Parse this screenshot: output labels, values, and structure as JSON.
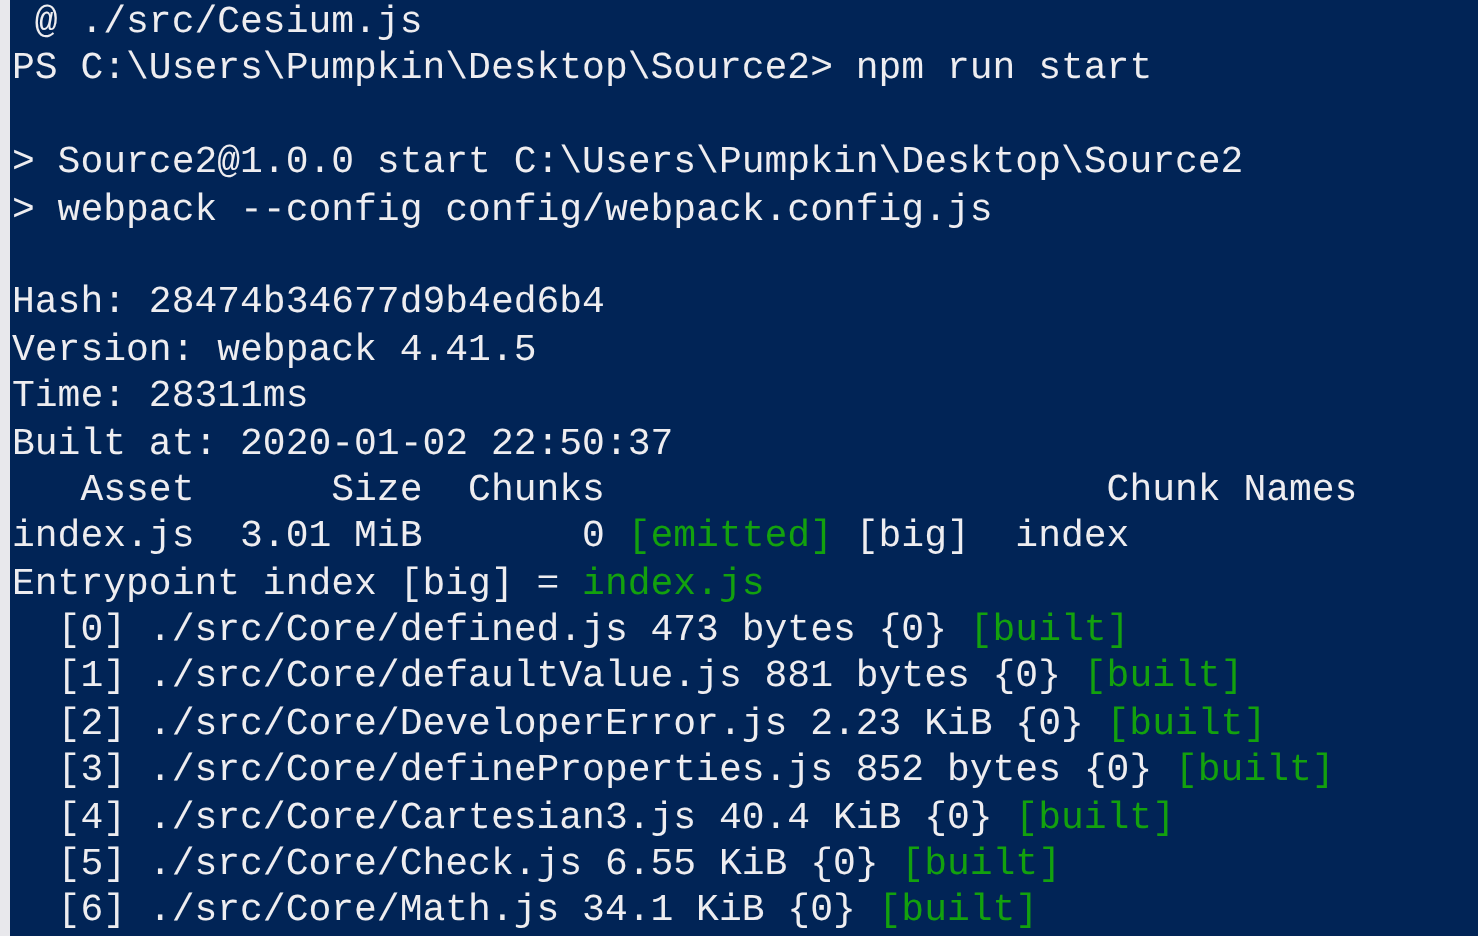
{
  "terminal": {
    "lines": [
      {
        "kind": "text",
        "segments": [
          {
            "text": " @ ./src/Cesium.js",
            "kind": "normal"
          }
        ]
      },
      {
        "kind": "text",
        "segments": [
          {
            "text": "PS C:\\Users\\Pumpkin\\Desktop\\Source2> npm run start",
            "kind": "normal"
          }
        ]
      },
      {
        "kind": "blank"
      },
      {
        "kind": "text",
        "segments": [
          {
            "text": "> Source2@1.0.0 start C:\\Users\\Pumpkin\\Desktop\\Source2",
            "kind": "normal"
          }
        ]
      },
      {
        "kind": "text",
        "segments": [
          {
            "text": "> webpack --config config/webpack.config.js",
            "kind": "normal"
          }
        ]
      },
      {
        "kind": "blank"
      },
      {
        "kind": "text",
        "segments": [
          {
            "text": "Hash: 28474b34677d9b4ed6b4",
            "kind": "normal"
          }
        ]
      },
      {
        "kind": "text",
        "segments": [
          {
            "text": "Version: webpack 4.41.5",
            "kind": "normal"
          }
        ]
      },
      {
        "kind": "text",
        "segments": [
          {
            "text": "Time: 28311ms",
            "kind": "normal"
          }
        ]
      },
      {
        "kind": "text",
        "segments": [
          {
            "text": "Built at: 2020-01-02 22:50:37",
            "kind": "normal"
          }
        ]
      },
      {
        "kind": "text",
        "segments": [
          {
            "text": "   Asset      Size  Chunks                      Chunk Names",
            "kind": "normal"
          }
        ]
      },
      {
        "kind": "text",
        "segments": [
          {
            "text": "index.js  3.01 MiB       0",
            "kind": "normal"
          },
          {
            "text": "[emitted]",
            "kind": "success"
          },
          {
            "text": "[big]  index",
            "kind": "normal"
          }
        ]
      },
      {
        "kind": "text",
        "segments": [
          {
            "text": "Entrypoint index [big] =",
            "kind": "normal"
          },
          {
            "text": "index.js",
            "kind": "success"
          }
        ]
      },
      {
        "kind": "text",
        "segments": [
          {
            "text": "  [0] ./src/Core/defined.js 473 bytes {0}",
            "kind": "normal"
          },
          {
            "text": "[built]",
            "kind": "success"
          }
        ]
      },
      {
        "kind": "text",
        "segments": [
          {
            "text": "  [1] ./src/Core/defaultValue.js 881 bytes {0}",
            "kind": "normal"
          },
          {
            "text": "[built]",
            "kind": "success"
          }
        ]
      },
      {
        "kind": "text",
        "segments": [
          {
            "text": "  [2] ./src/Core/DeveloperError.js 2.23 KiB {0}",
            "kind": "normal"
          },
          {
            "text": "[built]",
            "kind": "success"
          }
        ]
      },
      {
        "kind": "text",
        "segments": [
          {
            "text": "  [3] ./src/Core/defineProperties.js 852 bytes {0}",
            "kind": "normal"
          },
          {
            "text": "[built]",
            "kind": "success"
          }
        ]
      },
      {
        "kind": "text",
        "segments": [
          {
            "text": "  [4] ./src/Core/Cartesian3.js 40.4 KiB {0}",
            "kind": "normal"
          },
          {
            "text": "[built]",
            "kind": "success"
          }
        ]
      },
      {
        "kind": "text",
        "segments": [
          {
            "text": "  [5] ./src/Core/Check.js 6.55 KiB {0}",
            "kind": "normal"
          },
          {
            "text": "[built]",
            "kind": "success"
          }
        ]
      },
      {
        "kind": "text",
        "segments": [
          {
            "text": "  [6] ./src/Core/Math.js 34.1 KiB {0}",
            "kind": "normal"
          },
          {
            "text": "[built]",
            "kind": "success"
          }
        ]
      }
    ]
  }
}
